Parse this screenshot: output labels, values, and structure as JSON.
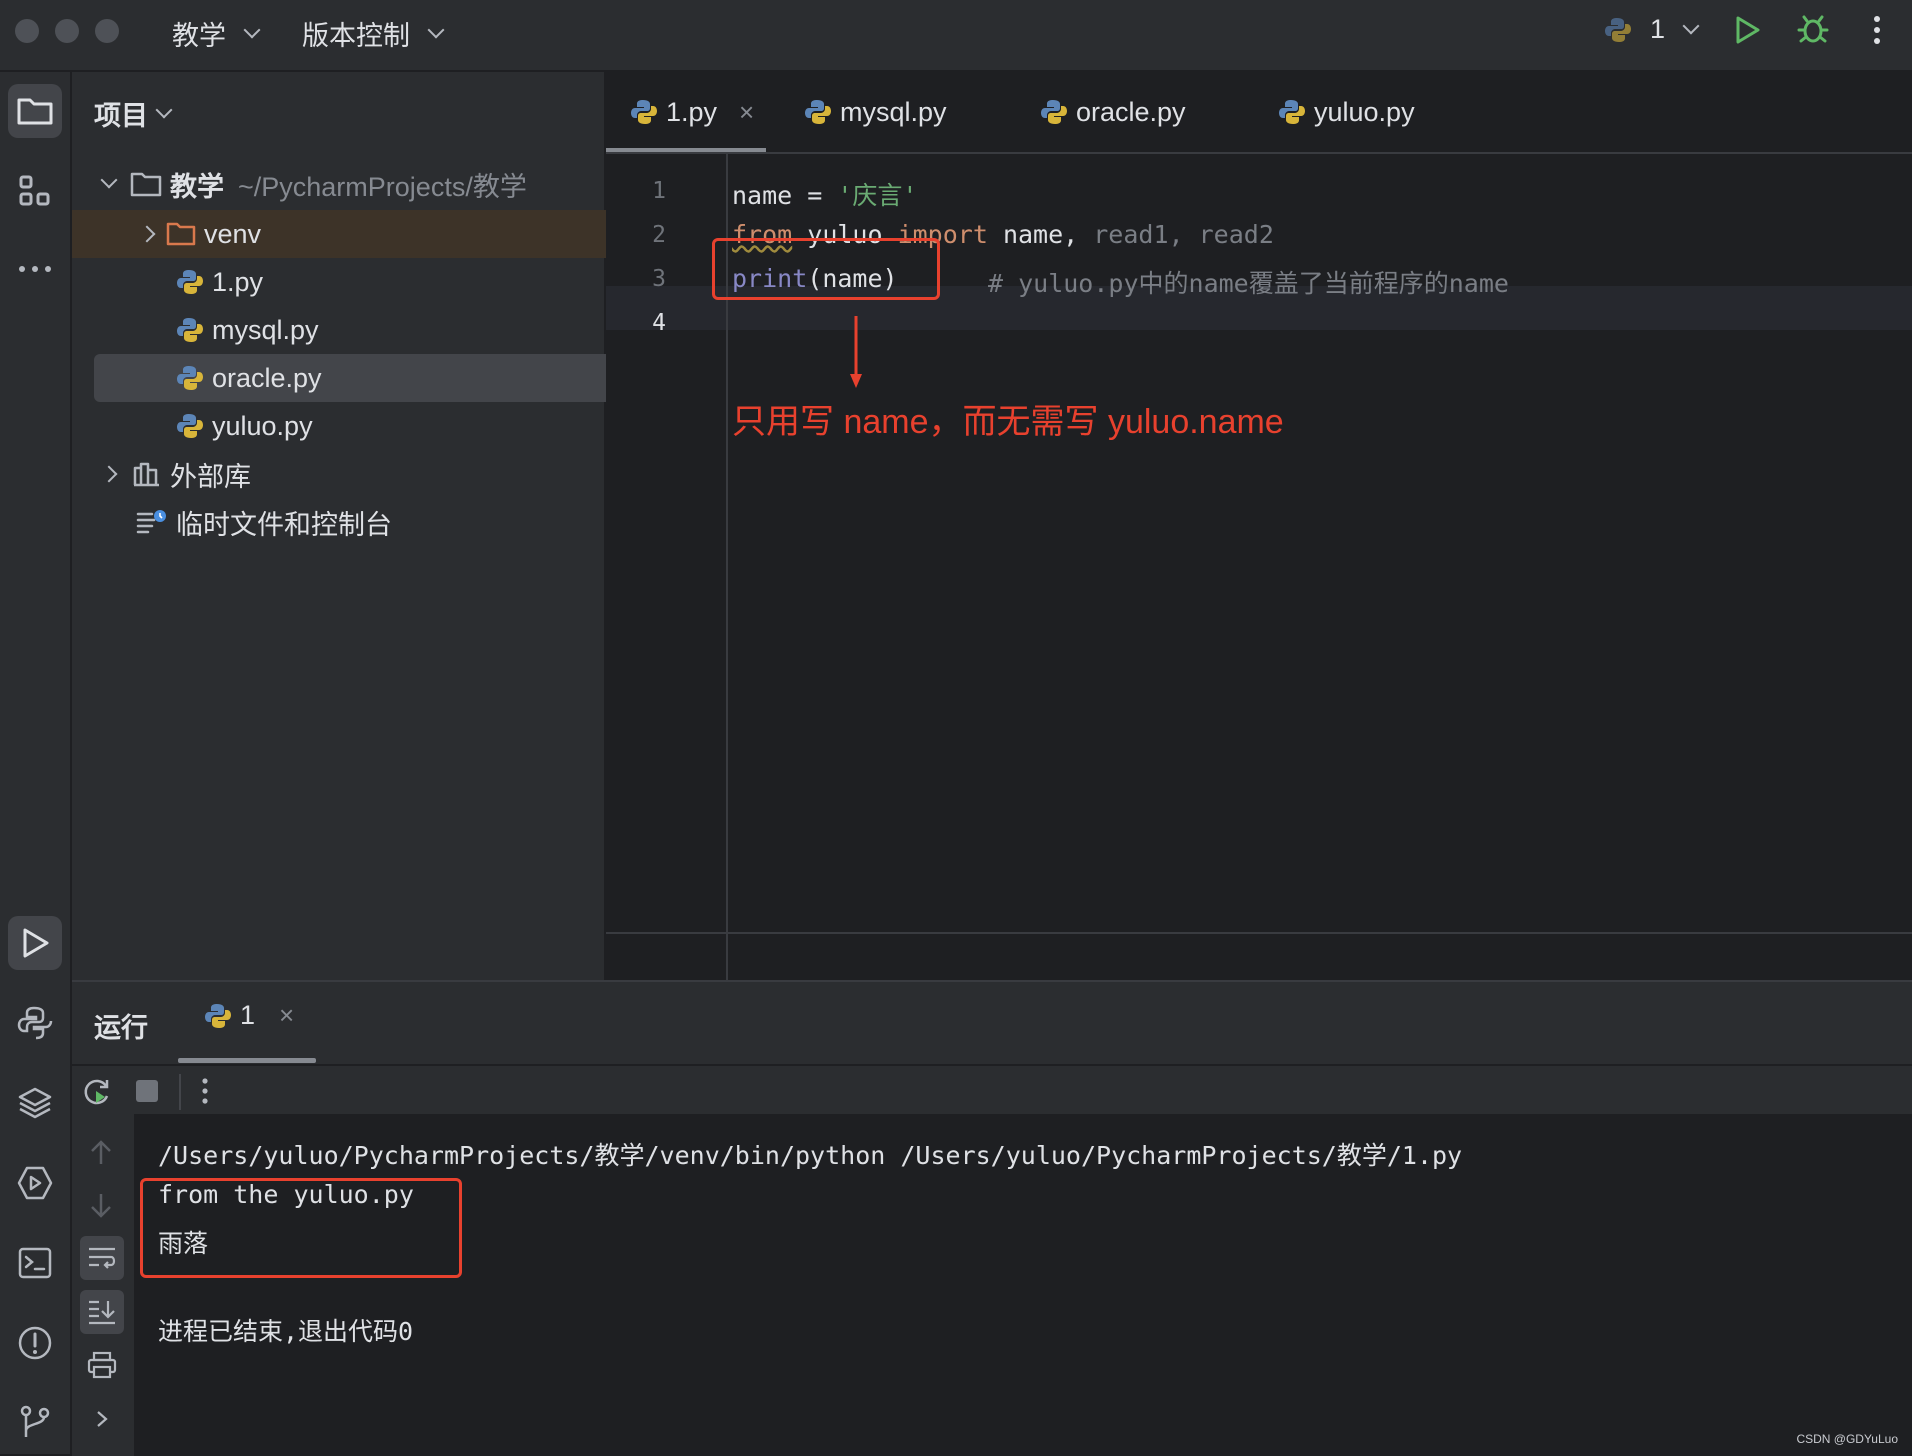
{
  "titlebar": {
    "project_menu": "教学",
    "vcs_menu": "版本控制",
    "run_config": "1"
  },
  "project_panel": {
    "title": "项目",
    "root_name": "教学",
    "root_path": "~/PycharmProjects/教学",
    "items": [
      {
        "label": "venv"
      },
      {
        "label": "1.py"
      },
      {
        "label": "mysql.py"
      },
      {
        "label": "oracle.py"
      },
      {
        "label": "yuluo.py"
      }
    ],
    "external_libs": "外部库",
    "scratches": "临时文件和控制台"
  },
  "editor": {
    "tabs": [
      {
        "label": "1.py",
        "active": true
      },
      {
        "label": "mysql.py"
      },
      {
        "label": "oracle.py"
      },
      {
        "label": "yuluo.py"
      }
    ],
    "line_numbers": [
      "1",
      "2",
      "3",
      "4"
    ],
    "code": {
      "l1_name": "name",
      "l1_eq": " = ",
      "l1_str": "'庆言'",
      "l2_from": "from",
      "l2_mod": " yuluo ",
      "l2_import": "import",
      "l2_names": " name, ",
      "l2_unused": "read1, read2",
      "l3_print": "print",
      "l3_args": "(name)",
      "l3_comment": "# yuluo.py中的name覆盖了当前程序的name"
    },
    "annotation": "只用写 name，而无需写 yuluo.name"
  },
  "run_panel": {
    "title": "运行",
    "tab_label": "1",
    "output": [
      "/Users/yuluo/PycharmProjects/教学/venv/bin/python /Users/yuluo/PycharmProjects/教学/1.py",
      "from the yuluo.py",
      "雨落",
      "",
      "进程已结束,退出代码0"
    ]
  },
  "watermark": "CSDN @GDYuLuo",
  "colors": {
    "accent_red": "#e8412e",
    "run_green": "#5fb865",
    "keyword": "#cf8e6d",
    "string": "#6aab73"
  }
}
